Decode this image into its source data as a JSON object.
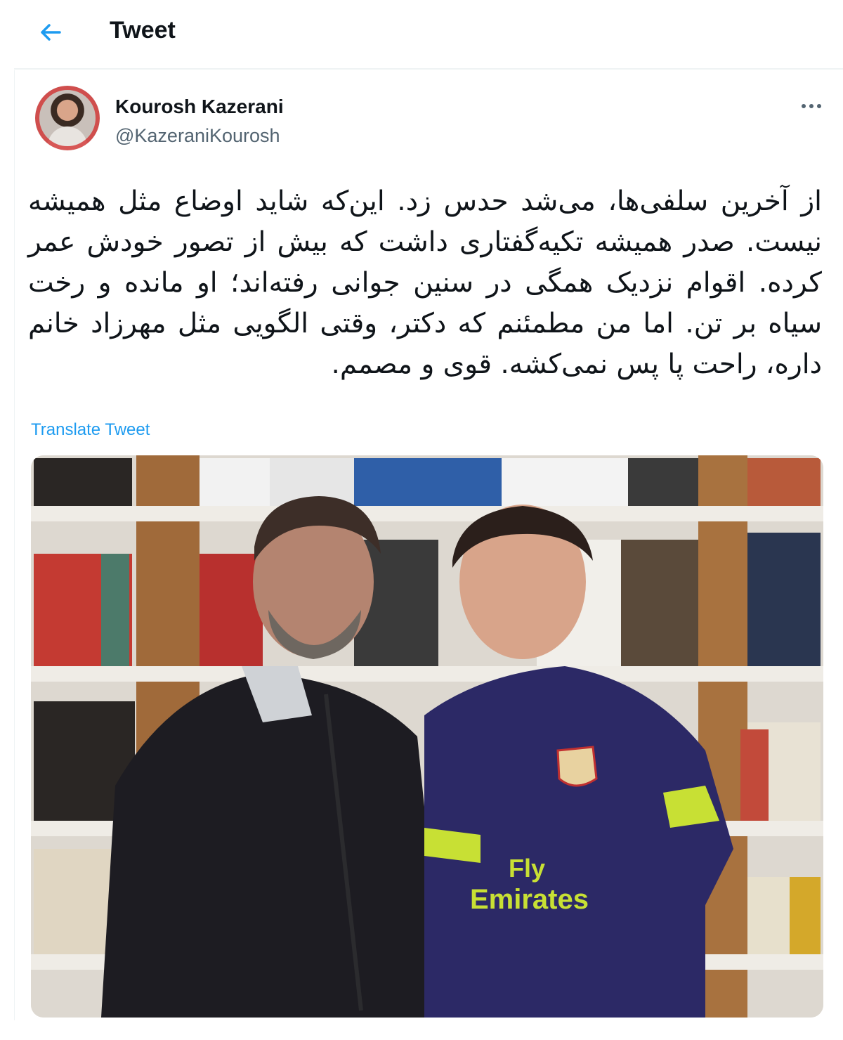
{
  "header": {
    "title": "Tweet"
  },
  "tweet": {
    "author_name": "Kourosh Kazerani",
    "author_handle": "@KazeraniKourosh",
    "text": "از آخرین سلفی‌ها، می‌شد حدس زد. این‌که شاید اوضاع مثل همیشه نیست. صدر همیشه تکیه‌گفتاری داشت که بیش از تصور خودش عمر کرده. اقوام نزدیک همگی در سنین جوانی رفته‌اند؛ او مانده و رخت سیاه بر تن. اما من مطمئنم که دکتر، وقتی الگویی مثل مهرزاد خانم داره، راحت پا پس نمی‌کشه. قوی و مصمم.",
    "translate_label": "Translate Tweet",
    "photo": {
      "jersey_lines": [
        "Fly",
        "Emirates"
      ]
    }
  },
  "colors": {
    "accent": "#1d9bf0",
    "text_primary": "#0f1419",
    "text_secondary": "#536471",
    "jersey": "#2c2966",
    "jersey_trim": "#c8e034"
  }
}
